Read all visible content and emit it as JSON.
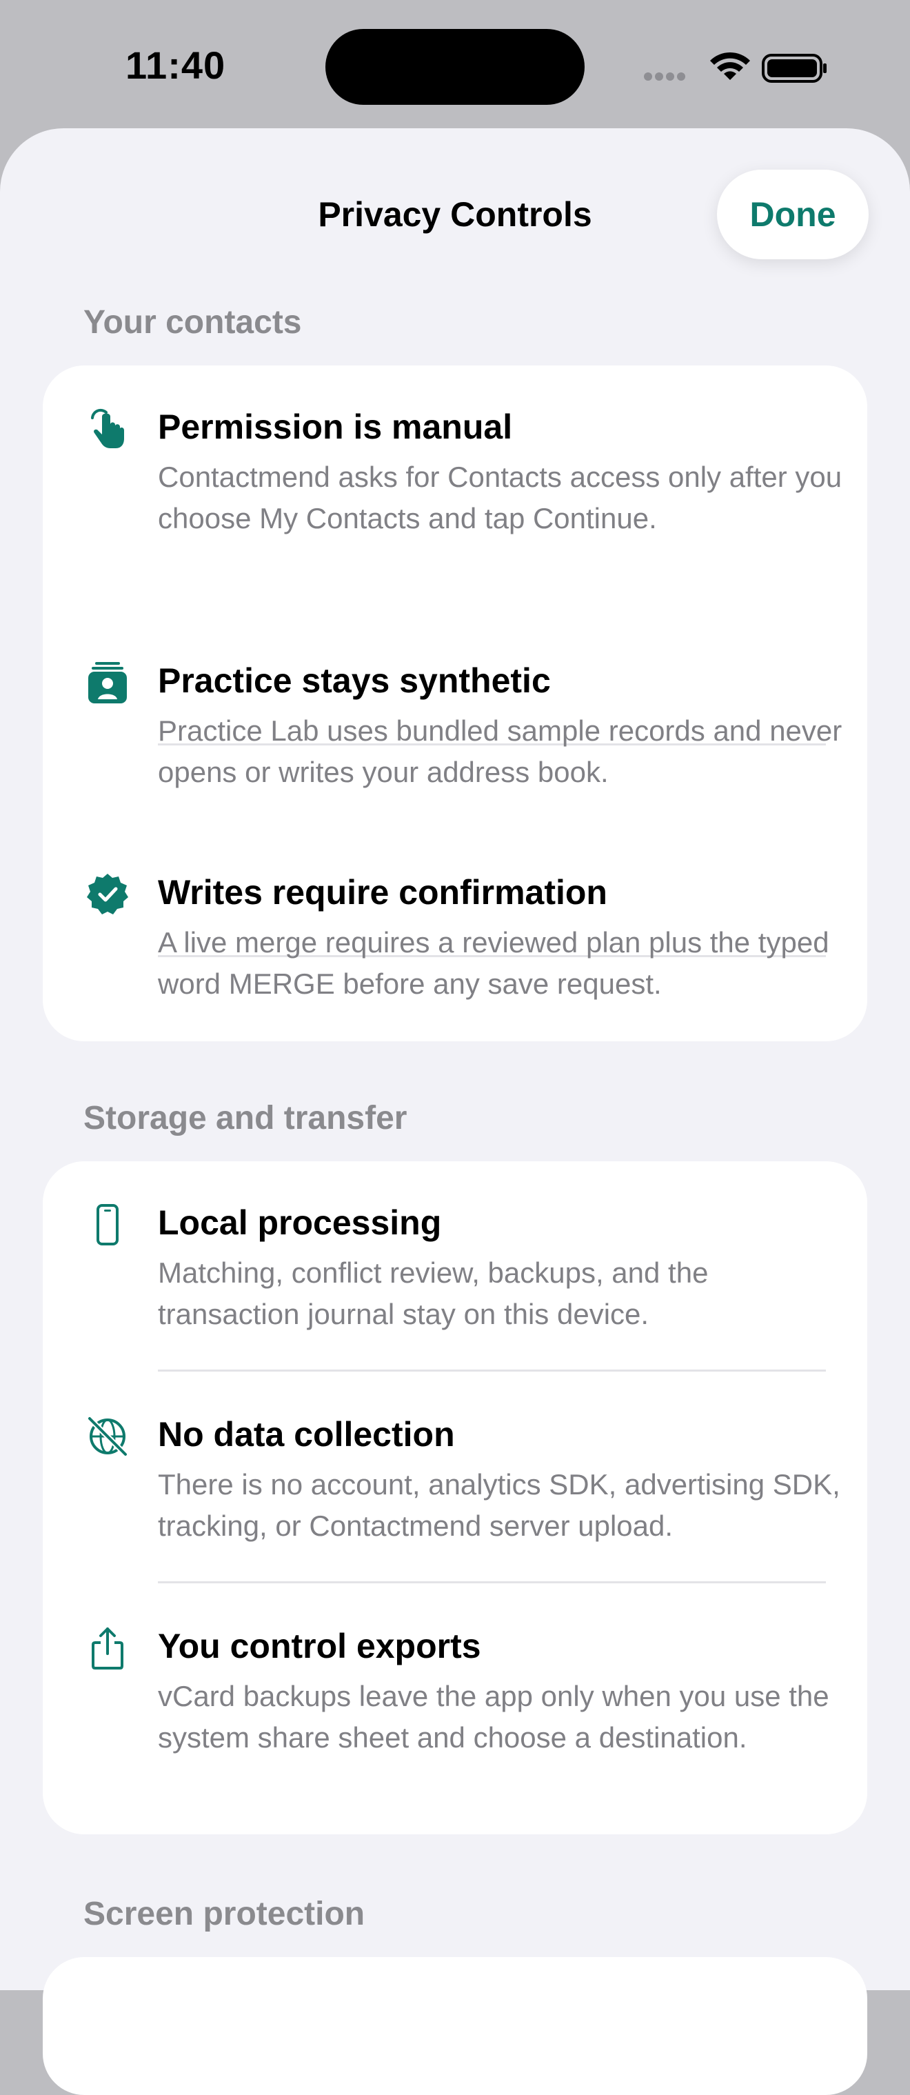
{
  "status_bar": {
    "time": "11:40"
  },
  "sheet": {
    "title": "Privacy Controls",
    "done_label": "Done"
  },
  "sections": [
    {
      "header": "Your contacts",
      "items": [
        {
          "icon": "hand-tap-icon",
          "title": "Permission is manual",
          "description": "Contactmend asks for Contacts access only after you choose My Contacts and tap Continue."
        },
        {
          "icon": "contact-card-icon",
          "title": "Practice stays synthetic",
          "description": "Practice Lab uses bundled sample records and never opens or writes your address book."
        },
        {
          "icon": "verified-seal-icon",
          "title": "Writes require confirmation",
          "description": "A live merge requires a reviewed plan plus the typed word MERGE before any save request."
        }
      ]
    },
    {
      "header": "Storage and transfer",
      "items": [
        {
          "icon": "phone-icon",
          "title": "Local processing",
          "description": "Matching, conflict review, backups, and the transaction journal stay on this device."
        },
        {
          "icon": "globe-slash-icon",
          "title": "No data collection",
          "description": "There is no account, analytics SDK, advertising SDK, tracking, or Contactmend server upload."
        },
        {
          "icon": "share-icon",
          "title": "You control exports",
          "description": "vCard backups leave the app only when you use the system share sheet and choose a destination."
        }
      ]
    },
    {
      "header": "Screen protection"
    }
  ],
  "colors": {
    "accent": "#0e7a6c",
    "secondary_text": "#808085",
    "section_header": "#8a8a8e",
    "sheet_background": "#f2f2f7"
  }
}
